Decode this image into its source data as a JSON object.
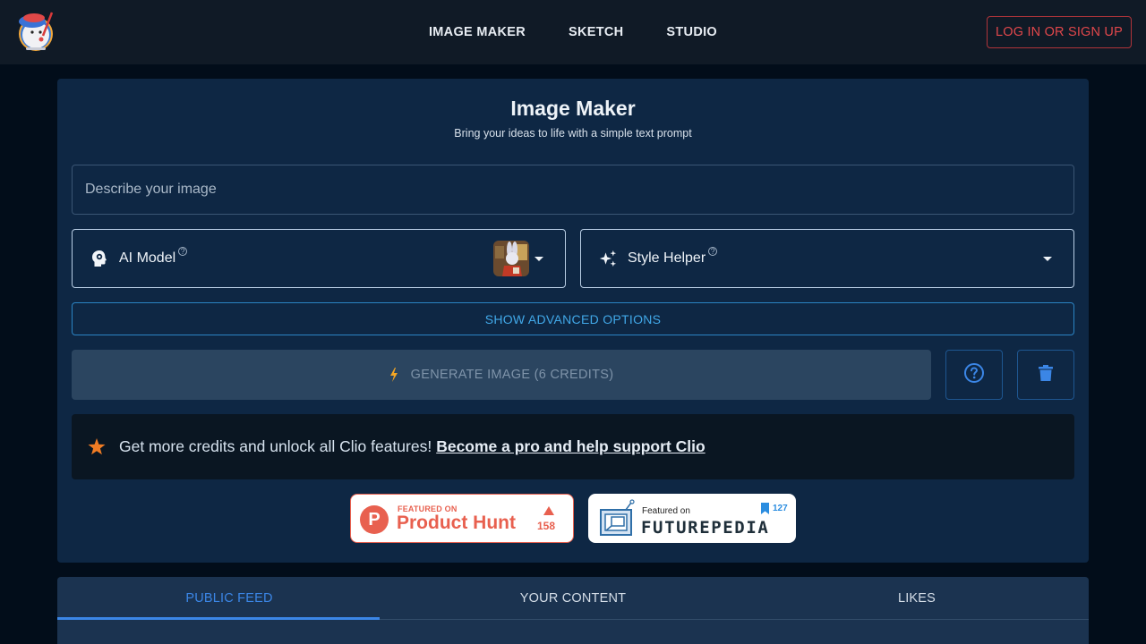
{
  "header": {
    "logo_alt": "Clio mascot logo",
    "nav": [
      {
        "label": "IMAGE MAKER"
      },
      {
        "label": "SKETCH"
      },
      {
        "label": "STUDIO"
      }
    ],
    "login_label": "LOG IN OR SIGN UP"
  },
  "maker": {
    "title": "Image Maker",
    "subtitle": "Bring your ideas to life with a simple text prompt",
    "prompt": {
      "value": "",
      "placeholder": "Describe your image"
    },
    "model_select": {
      "label": "AI Model",
      "help": "?",
      "icon": "head-gear-icon",
      "selected_thumb": "rabbit-cafe-thumbnail"
    },
    "style_select": {
      "label": "Style Helper",
      "help": "?",
      "icon": "sparkles-icon"
    },
    "advanced_label": "SHOW ADVANCED OPTIONS",
    "generate_label": "GENERATE IMAGE (6 CREDITS)",
    "help_icon": "help-circle-icon",
    "delete_icon": "trash-icon"
  },
  "promo": {
    "text": "Get more credits and unlock all Clio features!",
    "link": "Become a pro and help support Clio"
  },
  "badges": {
    "producthunt": {
      "small": "FEATURED ON",
      "big": "Product Hunt",
      "count": "158"
    },
    "futurepedia": {
      "small": "Featured on",
      "big": "FUTUREPEDIA",
      "count": "127"
    }
  },
  "feed_tabs": [
    {
      "label": "PUBLIC FEED",
      "active": true
    },
    {
      "label": "YOUR CONTENT",
      "active": false
    },
    {
      "label": "LIKES",
      "active": false
    }
  ],
  "colors": {
    "accent": "#3b86e6",
    "login": "#e0474b",
    "promo_star": "#f07c24",
    "producthunt": "#e8604f"
  }
}
